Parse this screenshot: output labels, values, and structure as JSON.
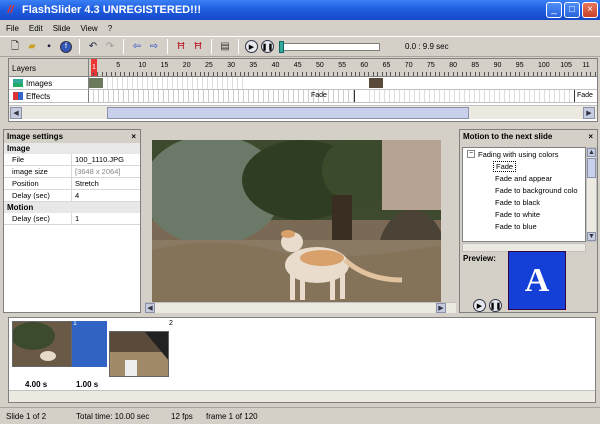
{
  "window": {
    "title": "FlashSlider 4.3 UNREGISTERED!!!"
  },
  "menu": [
    "File",
    "Edit",
    "Slide",
    "View",
    "?"
  ],
  "toolbar": {
    "time_readout": "0.0 : 9.9 sec"
  },
  "timeline": {
    "header": "Layers",
    "ticks": [
      "1",
      "5",
      "10",
      "15",
      "20",
      "25",
      "30",
      "35",
      "40",
      "45",
      "50",
      "55",
      "60",
      "65",
      "70",
      "75",
      "80",
      "85",
      "90",
      "95",
      "100",
      "105",
      "11"
    ],
    "tracks": [
      {
        "label": "Images"
      },
      {
        "label": "Effects",
        "markers": [
          "Fade",
          "Fade"
        ]
      }
    ]
  },
  "image_settings": {
    "title": "Image settings",
    "groups": [
      {
        "name": "Image",
        "rows": [
          {
            "key": "File",
            "value": "100_1110.JPG"
          },
          {
            "key": "image size",
            "value": "[3648 x 2064]"
          },
          {
            "key": "Position",
            "value": "Stretch"
          },
          {
            "key": "Delay (sec)",
            "value": "4"
          }
        ]
      },
      {
        "name": "Motion",
        "rows": [
          {
            "key": "Delay (sec)",
            "value": "1"
          }
        ]
      }
    ]
  },
  "motion": {
    "title": "Motion to the next slide",
    "group": "Fading with using colors",
    "items": [
      "Fade",
      "Fade and appear",
      "Fade to background colo",
      "Fade to black",
      "Fade to white",
      "Fade to blue"
    ],
    "preview_label": "Preview:",
    "preview_letter": "A"
  },
  "filmstrip": {
    "slides": [
      {
        "index": "1",
        "duration": "4.00 s",
        "transition": "1.00 s"
      },
      {
        "index": "2"
      }
    ]
  },
  "status": {
    "slide": "Slide 1 of 2",
    "total": "Total time: 10.00 sec",
    "fps": "12 fps",
    "frame": "frame 1 of 120"
  },
  "colors": {
    "title_bar": "#1f5ee0",
    "selection": "#3163c5",
    "preview_bg": "#1540d8"
  }
}
